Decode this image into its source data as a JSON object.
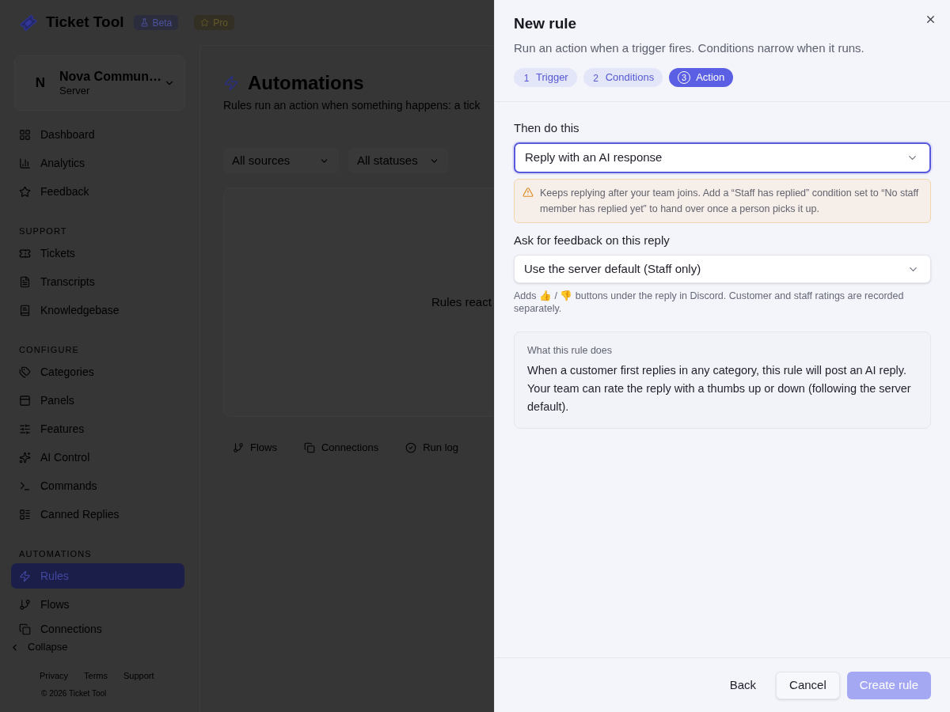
{
  "app": {
    "name": "Ticket Tool",
    "badges": [
      {
        "label": "Beta",
        "kind": "beta"
      },
      {
        "label": "Pro",
        "kind": "pro"
      }
    ]
  },
  "server": {
    "avatar": "N",
    "name": "Nova Commun…",
    "subtitle": "Server"
  },
  "sidebar": {
    "groups": [
      {
        "items": [
          {
            "label": "Dashboard",
            "selected": false
          },
          {
            "label": "Analytics",
            "selected": false
          },
          {
            "label": "Feedback",
            "selected": false
          }
        ]
      },
      {
        "heading": "SUPPORT",
        "items": [
          {
            "label": "Tickets",
            "selected": false
          },
          {
            "label": "Transcripts",
            "selected": false
          },
          {
            "label": "Knowledgebase",
            "selected": false
          }
        ]
      },
      {
        "heading": "CONFIGURE",
        "items": [
          {
            "label": "Categories",
            "selected": false
          },
          {
            "label": "Panels",
            "selected": false
          },
          {
            "label": "Features",
            "selected": false
          },
          {
            "label": "AI Control",
            "selected": false
          },
          {
            "label": "Commands",
            "selected": false
          },
          {
            "label": "Canned Replies",
            "selected": false
          }
        ]
      },
      {
        "heading": "AUTOMATIONS",
        "items": [
          {
            "label": "Rules",
            "selected": true
          },
          {
            "label": "Flows",
            "selected": false
          },
          {
            "label": "Connections",
            "selected": false
          }
        ]
      }
    ],
    "collapse": "Collapse",
    "footer_links": [
      "Privacy",
      "Terms",
      "Support"
    ],
    "copyright": "© 2026 Ticket Tool"
  },
  "page": {
    "title": "Automations",
    "subtitle": "Rules run an action when something happens: a tick",
    "filters": [
      "All sources",
      "All statuses"
    ],
    "empty_text": "Rules react",
    "links": [
      "Flows",
      "Connections",
      "Run log"
    ]
  },
  "drawer": {
    "title": "New rule",
    "subtitle": "Run an action when a trigger fires. Conditions narrow when it runs.",
    "steps": [
      {
        "number": "1",
        "label": "Trigger",
        "selected": false
      },
      {
        "number": "2",
        "label": "Conditions",
        "selected": false
      },
      {
        "number": "3",
        "label": "Action",
        "selected": true
      }
    ],
    "fields": [
      {
        "label": "Then do this",
        "value": "Reply with an AI response",
        "focused": true,
        "warning": "Keeps replying after your team joins. Add a “Staff has replied” condition set to “No staff member has replied yet” to hand over once a person picks it up."
      },
      {
        "label": "Ask for feedback on this reply",
        "value": "Use the server default (Staff only)",
        "focused": false,
        "hint": "Adds 👍 / 👎 buttons under the reply in Discord. Customer and staff ratings are recorded separately."
      }
    ],
    "summary": {
      "heading": "What this rule does",
      "text": "When a customer first replies in any category, this rule will post an AI reply. Your team can rate the reply with a thumbs up or down (following the server default)."
    },
    "buttons": [
      {
        "label": "Back",
        "kind": "ghost",
        "disabled": false
      },
      {
        "label": "Cancel",
        "kind": "outline",
        "disabled": false
      },
      {
        "label": "Create rule",
        "kind": "primary",
        "disabled": true
      }
    ]
  }
}
